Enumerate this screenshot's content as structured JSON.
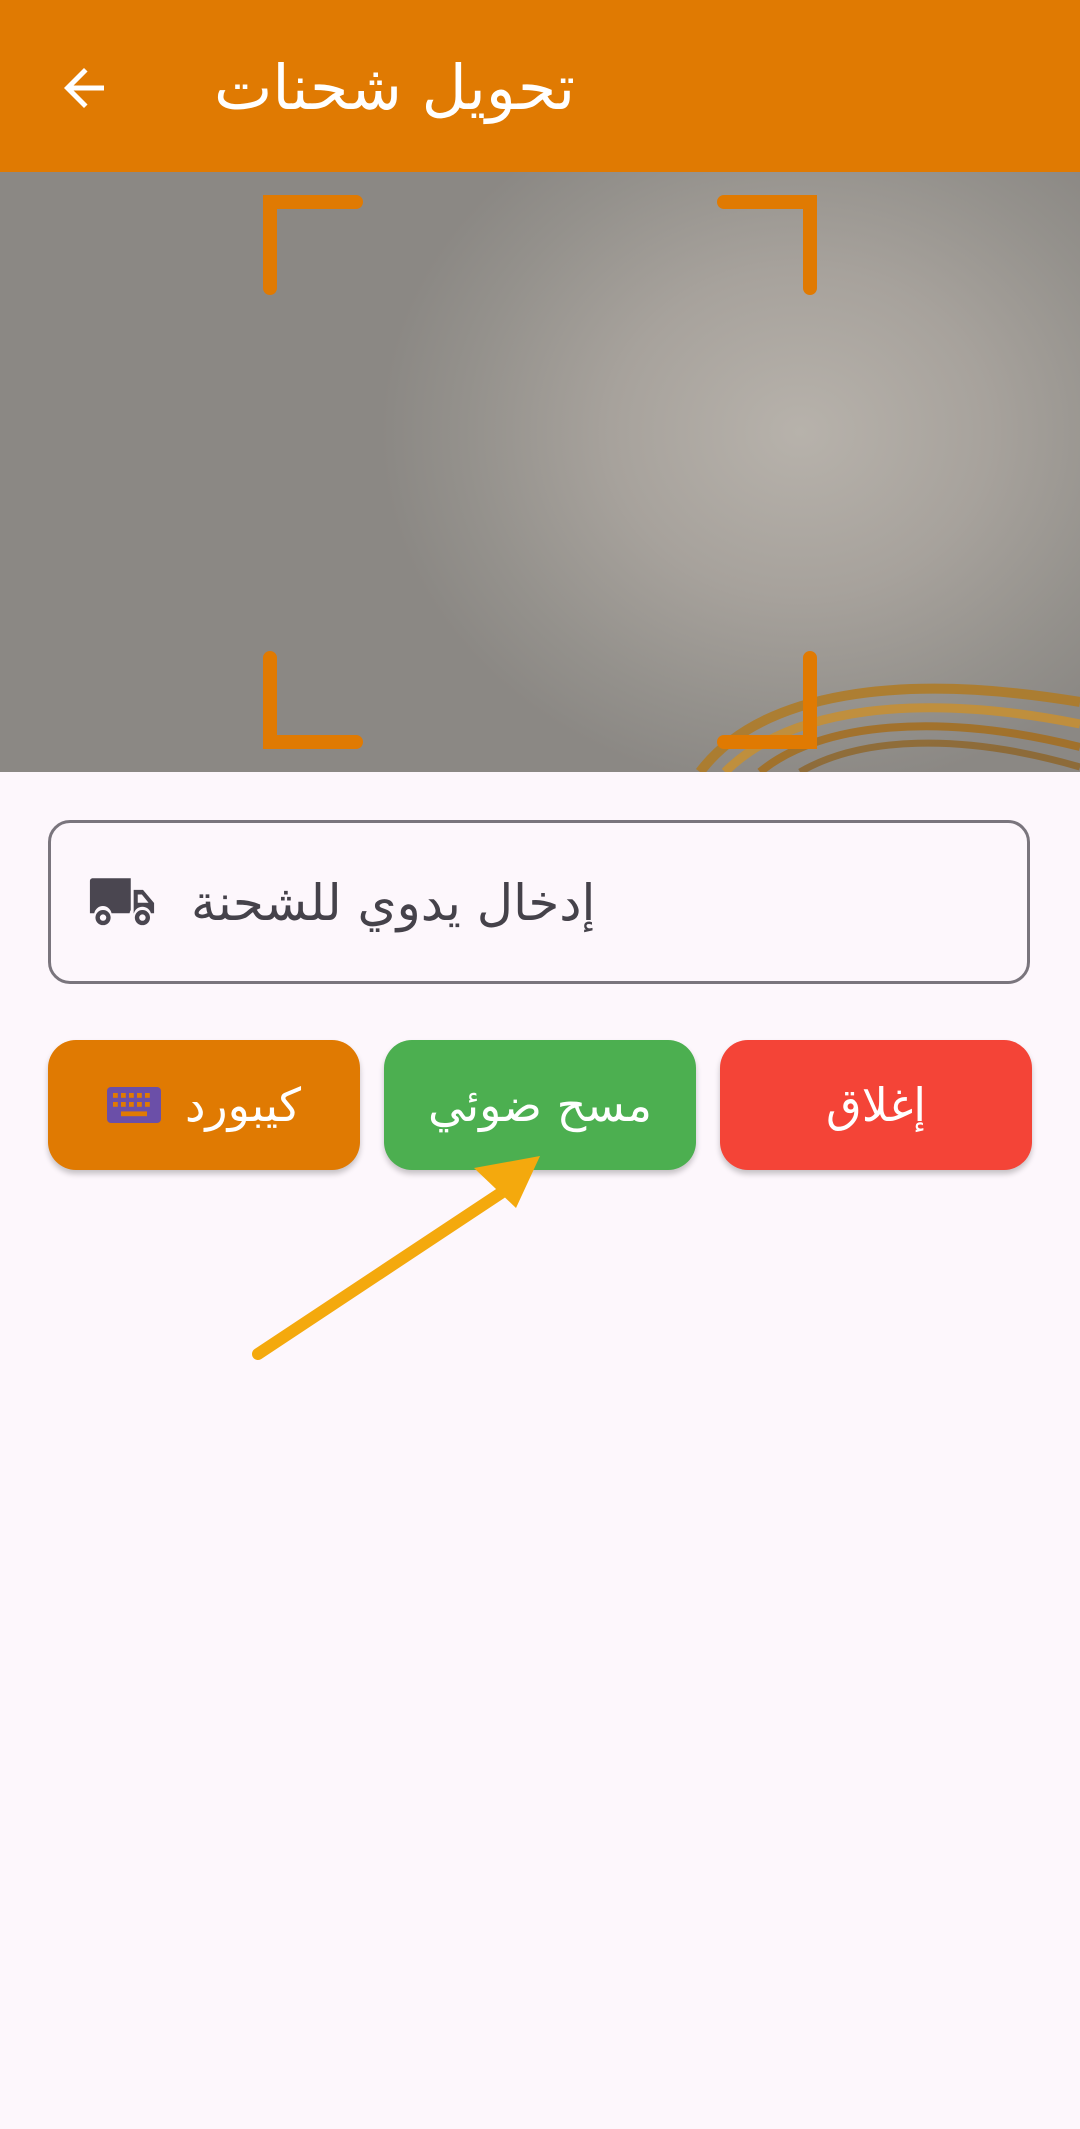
{
  "app_bar": {
    "title": "تحويل شحنات",
    "back_icon": "arrow-left-icon",
    "background": "#e07a02"
  },
  "manual_entry": {
    "label": "إدخال يدوي للشحنة",
    "icon": "truck-icon"
  },
  "buttons": {
    "keyboard_label": "كيبورد",
    "keyboard_icon": "keyboard-icon",
    "scan_label": "مسح ضوئي",
    "close_label": "إغلاق"
  },
  "colors": {
    "accent": "#e07a02",
    "scan": "#4caf50",
    "close": "#f44437",
    "keyboard_icon": "#6b4fa8",
    "annotation_arrow": "#f4a90d"
  }
}
